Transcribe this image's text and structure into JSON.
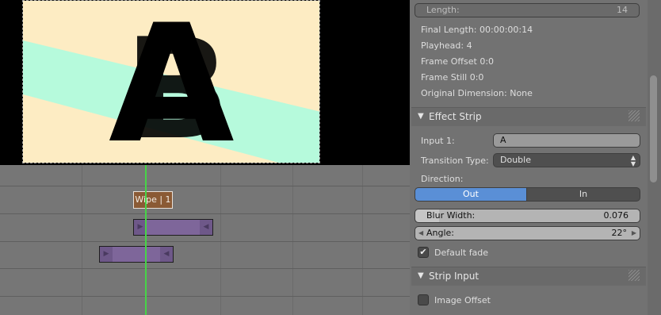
{
  "preview": {
    "letters": [
      "A",
      "B"
    ],
    "colors": {
      "primary": "#fdecc3",
      "secondary": "#b6fadc",
      "ink": "#000000"
    }
  },
  "timeline": {
    "wipe_label": "Wipe | 1",
    "playhead_color": "#47d447"
  },
  "panel": {
    "length": {
      "label": "Length:",
      "value": "14"
    },
    "info": [
      "Final Length: 00:00:00:14",
      "Playhead: 4",
      "Frame Offset 0:0",
      "Frame Still 0:0",
      "Original Dimension: None"
    ],
    "effect_strip": {
      "title": "Effect Strip",
      "input1_label": "Input 1:",
      "input1_value": "A",
      "transition_label": "Transition Type:",
      "transition_value": "Double",
      "direction_label": "Direction:",
      "direction_out": "Out",
      "direction_in": "In",
      "blur_label": "Blur Width:",
      "blur_value": "0.076",
      "angle_label": "Angle:",
      "angle_value": "22°",
      "default_fade_label": "Default fade",
      "default_fade_checked": true
    },
    "strip_input": {
      "title": "Strip Input",
      "image_offset_label": "Image Offset",
      "image_offset_checked": false
    },
    "accent": "#5a8fd6"
  }
}
